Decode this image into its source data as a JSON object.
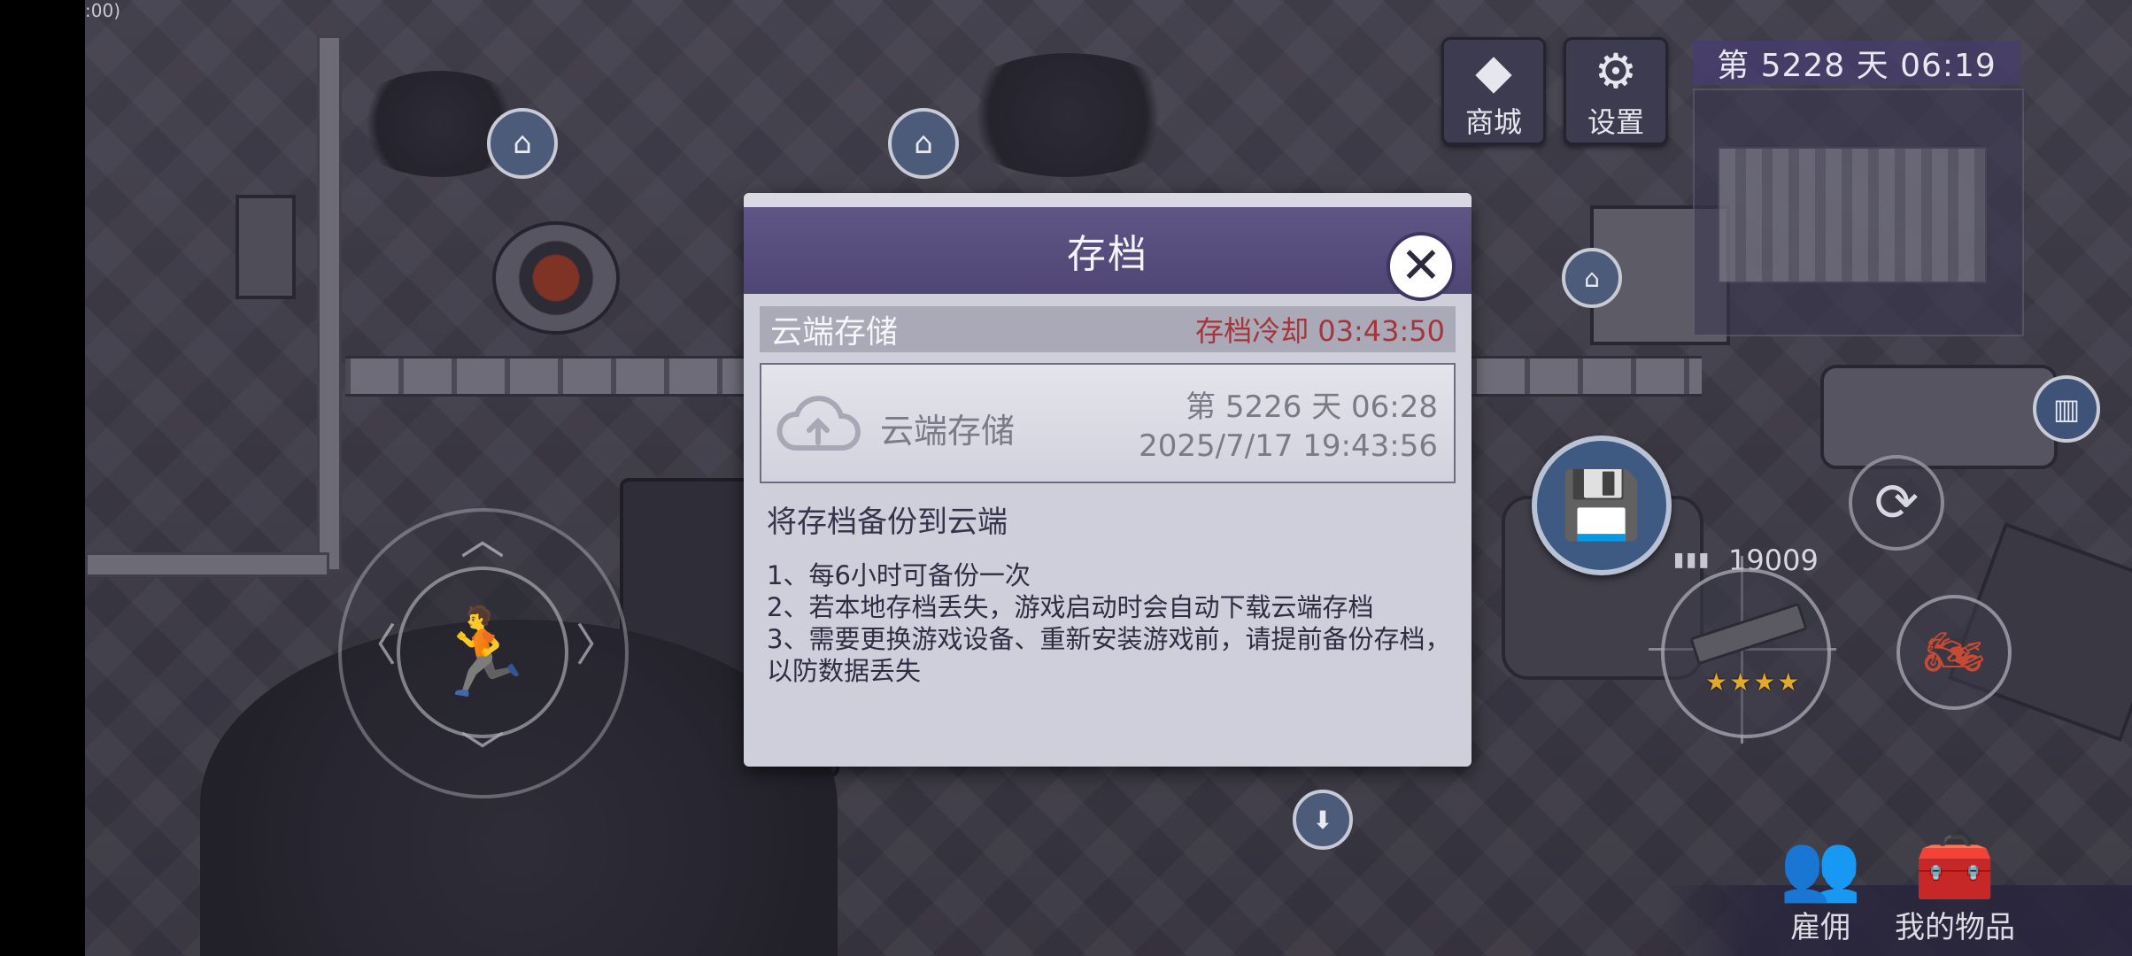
{
  "hud": {
    "corner_time_fragment": ":00)",
    "shop_label": "商城",
    "shop_icon": "diamond-icon",
    "settings_label": "设置",
    "settings_icon": "gear-icon",
    "day_banner": "第 5228 天   06:19",
    "ammo_count": "19009",
    "weapon_stars": "★★★★",
    "hire_label": "雇佣",
    "hire_icon": "people-icon",
    "items_label": "我的物品",
    "items_icon": "chest-icon"
  },
  "dialog": {
    "title": "存档",
    "section_title": "云端存储",
    "cooldown_text": "存档冷却 03:43:50",
    "cloud_card": {
      "label": "云端存储",
      "day_time": "第 5226 天   06:28",
      "timestamp": "2025/7/17 19:43:56",
      "icon": "cloud-upload-icon"
    },
    "description_title": "将存档备份到云端",
    "rules": [
      "1、每6小时可备份一次",
      "2、若本地存档丢失，游戏启动时会自动下载云端存档",
      "3、需要更换游戏设备、重新安装游戏前，请提前备份存档，以防数据丢失"
    ]
  },
  "colors": {
    "dialog_header": "#574e7e",
    "cooldown": "#a6353a",
    "dialog_bg": "#cfcfdc",
    "star": "#e2a92a"
  }
}
